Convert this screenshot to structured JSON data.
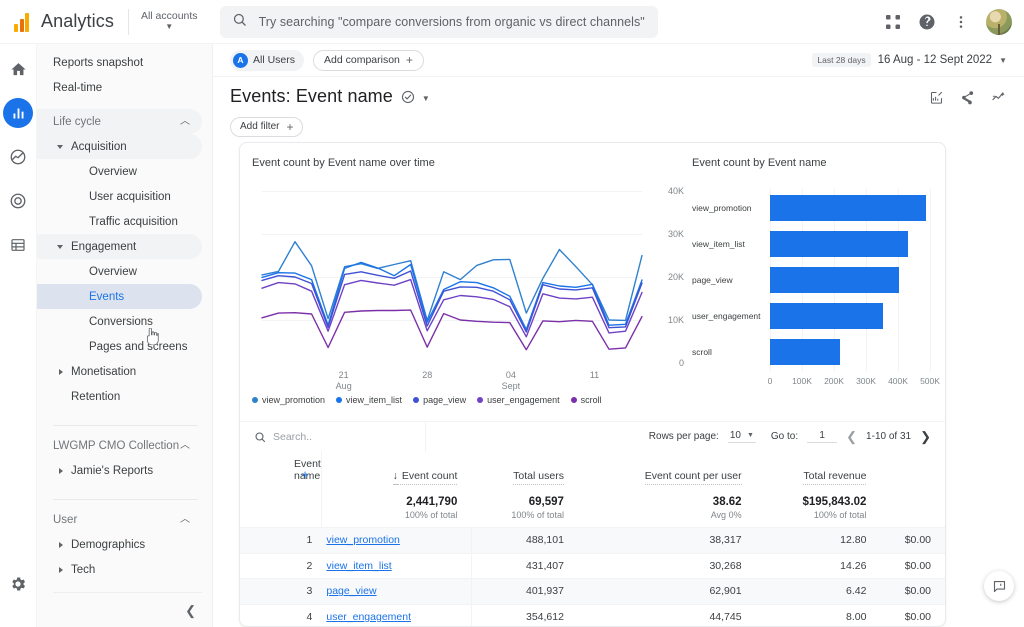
{
  "topbar": {
    "brand": "Analytics",
    "account_label": "All accounts",
    "search_placeholder": "Try searching \"compare conversions from organic vs direct channels\"",
    "icons": {
      "apps": "apps-grid-icon",
      "help": "help-circle-icon",
      "more": "more-vert-icon",
      "avatar": "avatar"
    }
  },
  "rail": {
    "items": [
      {
        "name": "home-icon",
        "label": "Home"
      },
      {
        "name": "reports-icon",
        "label": "Reports"
      },
      {
        "name": "explore-icon",
        "label": "Explore"
      },
      {
        "name": "advertising-icon",
        "label": "Advertising"
      },
      {
        "name": "library-icon",
        "label": "Library"
      }
    ],
    "settings": "Admin"
  },
  "sidebar": {
    "items": [
      {
        "label": "Reports snapshot",
        "level": 0,
        "type": "link"
      },
      {
        "label": "Real-time",
        "level": 0,
        "type": "link"
      },
      {
        "label": "Life cycle",
        "level": 0,
        "type": "section",
        "expanded": true
      },
      {
        "label": "Acquisition",
        "level": 1,
        "type": "group",
        "expanded": true
      },
      {
        "label": "Overview",
        "level": 2,
        "type": "link"
      },
      {
        "label": "User acquisition",
        "level": 2,
        "type": "link"
      },
      {
        "label": "Traffic acquisition",
        "level": 2,
        "type": "link"
      },
      {
        "label": "Engagement",
        "level": 1,
        "type": "group",
        "expanded": true
      },
      {
        "label": "Overview",
        "level": 2,
        "type": "link"
      },
      {
        "label": "Events",
        "level": 2,
        "type": "link",
        "selected": true
      },
      {
        "label": "Conversions",
        "level": 2,
        "type": "link"
      },
      {
        "label": "Pages and screens",
        "level": 2,
        "type": "link"
      },
      {
        "label": "Monetisation",
        "level": 1,
        "type": "group",
        "expanded": false
      },
      {
        "label": "Retention",
        "level": 1,
        "type": "link"
      },
      {
        "label": "LWGMP CMO Collection",
        "level": 0,
        "type": "section",
        "expanded": true
      },
      {
        "label": "Jamie's Reports",
        "level": 1,
        "type": "group",
        "expanded": false
      },
      {
        "label": "User",
        "level": 0,
        "type": "section",
        "expanded": true
      },
      {
        "label": "Demographics",
        "level": 1,
        "type": "group",
        "expanded": false
      },
      {
        "label": "Tech",
        "level": 1,
        "type": "group",
        "expanded": false
      }
    ],
    "collapse_icon": "chevron-left-icon"
  },
  "context": {
    "audience_badge": "A",
    "audience_label": "All Users",
    "add_comparison_label": "Add comparison",
    "date_pill": "Last 28 days",
    "date_range": "16 Aug - 12 Sept 2022"
  },
  "report": {
    "title": "Events: Event name",
    "add_filter_label": "Add filter",
    "actions": [
      {
        "name": "edit-chart-icon"
      },
      {
        "name": "share-icon"
      },
      {
        "name": "insights-icon"
      }
    ]
  },
  "table_controls": {
    "search_placeholder": "Search..",
    "rows_per_page_label": "Rows per page:",
    "rows_per_page_value": "10",
    "goto_label": "Go to:",
    "goto_value": "1",
    "range_text": "1-10 of 31"
  },
  "table": {
    "columns": [
      "Event name",
      "Event count",
      "Total users",
      "Event count per user",
      "Total revenue"
    ],
    "sorted_column": "Event count",
    "totals": [
      {
        "value": "2,441,790",
        "sub": "100% of total"
      },
      {
        "value": "69,597",
        "sub": "100% of total"
      },
      {
        "value": "38.62",
        "sub": "Avg 0%"
      },
      {
        "value": "$195,843.02",
        "sub": "100% of total"
      }
    ],
    "rows": [
      {
        "index": "1",
        "name": "view_promotion",
        "event_count": "488,101",
        "total_users": "38,317",
        "per_user": "12.80",
        "revenue": "$0.00"
      },
      {
        "index": "2",
        "name": "view_item_list",
        "event_count": "431,407",
        "total_users": "30,268",
        "per_user": "14.26",
        "revenue": "$0.00"
      },
      {
        "index": "3",
        "name": "page_view",
        "event_count": "401,937",
        "total_users": "62,901",
        "per_user": "6.42",
        "revenue": "$0.00"
      },
      {
        "index": "4",
        "name": "user_engagement",
        "event_count": "354,612",
        "total_users": "44,745",
        "per_user": "8.00",
        "revenue": "$0.00"
      }
    ]
  },
  "chart_data": [
    {
      "type": "line",
      "title": "Event count by Event name over time",
      "xlabel": "",
      "ylabel": "",
      "ylim": [
        0,
        40000
      ],
      "yticks": [
        "0",
        "10K",
        "20K",
        "30K",
        "40K"
      ],
      "ytick_values": [
        0,
        10000,
        20000,
        30000,
        40000
      ],
      "grid": true,
      "legend_position": "bottom",
      "xticks": [
        {
          "label": "21",
          "sublabel": "Aug",
          "pos": 0.215
        },
        {
          "label": "28",
          "sublabel": "",
          "pos": 0.435
        },
        {
          "label": "04",
          "sublabel": "Sept",
          "pos": 0.655
        },
        {
          "label": "11",
          "sublabel": "",
          "pos": 0.875
        }
      ],
      "series": [
        {
          "name": "view_promotion",
          "color": "#3080d0",
          "values": [
            20500,
            21300,
            28200,
            22600,
            10300,
            22400,
            23100,
            22000,
            22900,
            23800,
            9900,
            21200,
            19400,
            22700,
            24000,
            24100,
            11600,
            19700,
            26400,
            22400,
            18200,
            10000,
            9900,
            25000
          ]
        },
        {
          "name": "view_item_list",
          "color": "#1a73e8",
          "values": [
            19900,
            21000,
            20900,
            19400,
            8800,
            22000,
            23400,
            22100,
            20300,
            22900,
            9500,
            17100,
            18900,
            18700,
            17500,
            15500,
            7800,
            18700,
            17900,
            17600,
            18300,
            8800,
            9000,
            19300
          ]
        },
        {
          "name": "page_view",
          "color": "#3f51d5",
          "values": [
            19200,
            20300,
            20000,
            18500,
            8300,
            20600,
            21200,
            20400,
            19700,
            21400,
            8600,
            16700,
            17700,
            17600,
            16700,
            14700,
            7200,
            18200,
            17200,
            17000,
            17500,
            8200,
            8400,
            18600
          ]
        },
        {
          "name": "user_engagement",
          "color": "#6f42c6",
          "values": [
            17400,
            18700,
            18400,
            16700,
            7400,
            18200,
            19200,
            18600,
            18100,
            19400,
            7500,
            14700,
            15700,
            15400,
            14800,
            13100,
            6100,
            16100,
            15100,
            14900,
            15300,
            7000,
            7400,
            16400
          ]
        },
        {
          "name": "scroll",
          "color": "#7b2fa8",
          "values": [
            10500,
            11600,
            11700,
            11400,
            3600,
            11800,
            12100,
            12200,
            12200,
            12300,
            3700,
            11500,
            10000,
            9700,
            9500,
            9400,
            3100,
            9800,
            9600,
            9900,
            9700,
            3200,
            3500,
            10800
          ]
        }
      ]
    },
    {
      "type": "bar",
      "orientation": "horizontal",
      "title": "Event count by Event name",
      "categories": [
        "view_promotion",
        "view_item_list",
        "page_view",
        "user_engagement",
        "scroll"
      ],
      "values": [
        488101,
        431407,
        401937,
        354612,
        219000
      ],
      "xlim": [
        0,
        500000
      ],
      "xticks": [
        "0",
        "100K",
        "200K",
        "300K",
        "400K",
        "500K"
      ],
      "xtick_values": [
        0,
        100000,
        200000,
        300000,
        400000,
        500000
      ],
      "bar_color": "#1a73e8",
      "grid": true
    }
  ],
  "feedback": {
    "icon": "feedback-icon"
  }
}
